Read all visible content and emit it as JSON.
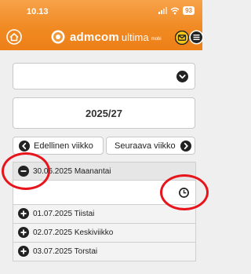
{
  "status_bar": {
    "time": "10.13",
    "battery": "93",
    "icons": [
      "signal-icon",
      "wifi-icon",
      "battery-icon"
    ]
  },
  "header": {
    "brand": "admcom",
    "product": "ultima",
    "edition": "mobi",
    "icons": [
      "home-icon",
      "admcom-logo-icon",
      "mail-icon",
      "menu-icon"
    ]
  },
  "selector": {
    "value": ""
  },
  "week": "2025/27",
  "nav": {
    "prev_label": "Edellinen viikko",
    "next_label": "Seuraava viikko"
  },
  "days": [
    {
      "label": "30.06.2025 Maanantai",
      "expanded": true
    },
    {
      "label": "01.07.2025 Tiistai",
      "expanded": false
    },
    {
      "label": "02.07.2025 Keskiviikko",
      "expanded": false
    },
    {
      "label": "03.07.2025 Torstai",
      "expanded": false
    }
  ],
  "colors": {
    "header_orange": "#f08a23",
    "annotation_red": "#e8141b",
    "icon_dark": "#222222"
  }
}
